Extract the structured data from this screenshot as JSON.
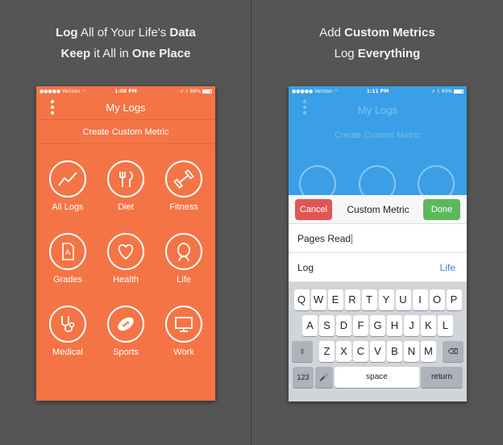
{
  "left": {
    "headline1": {
      "bold1": "Log",
      "mid": " All of Your Life's ",
      "bold2": "Data"
    },
    "headline2": {
      "bold1": "Keep",
      "mid": " it All in ",
      "bold2": "One Place"
    },
    "phone": {
      "status": {
        "carrier": "●●●●● Verizon",
        "time": "1:08 PM",
        "battery": "88%",
        "battery_level": 0.88
      },
      "title": "My Logs",
      "create_label": "Create Custom Metric",
      "accent": "#f47445",
      "categories": [
        {
          "label": "All Logs",
          "icon": "line-chart-icon"
        },
        {
          "label": "Diet",
          "icon": "fork-knife-icon"
        },
        {
          "label": "Fitness",
          "icon": "dumbbell-icon"
        },
        {
          "label": "Grades",
          "icon": "grade-paper-icon"
        },
        {
          "label": "Health",
          "icon": "heart-icon"
        },
        {
          "label": "Life",
          "icon": "person-head-icon"
        },
        {
          "label": "Medical",
          "icon": "stethoscope-icon"
        },
        {
          "label": "Sports",
          "icon": "football-icon"
        },
        {
          "label": "Work",
          "icon": "monitor-icon"
        }
      ]
    }
  },
  "right": {
    "headline1": {
      "mid": "Add ",
      "bold": "Custom Metrics"
    },
    "headline2": {
      "mid": "Log ",
      "bold": "Everything"
    },
    "phone": {
      "status": {
        "carrier": "●●●●● Verizon",
        "time": "1:11 PM",
        "battery": "90%",
        "battery_level": 0.9
      },
      "bg_title": "My Logs",
      "bg_create": "Create Custom Metric",
      "accent": "#3a9fe6",
      "cancel_label": "Cancel",
      "modal_title": "Custom Metric",
      "done_label": "Done",
      "name_value": "Pages Read",
      "log_label": "Log",
      "log_value": "Life",
      "keyboard": {
        "row1": [
          "Q",
          "W",
          "E",
          "R",
          "T",
          "Y",
          "U",
          "I",
          "O",
          "P"
        ],
        "row2": [
          "A",
          "S",
          "D",
          "F",
          "G",
          "H",
          "J",
          "K",
          "L"
        ],
        "row3": [
          "Z",
          "X",
          "C",
          "V",
          "B",
          "N",
          "M"
        ],
        "numbers_key": "123",
        "space_key": "space",
        "return_key": "return"
      }
    }
  }
}
